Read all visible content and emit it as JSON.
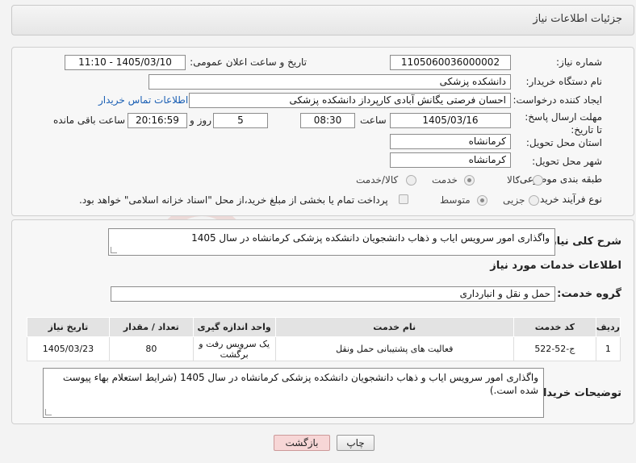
{
  "header": {
    "title": "جزئیات اطلاعات نیاز"
  },
  "fields": {
    "need_number_label": "شماره نیاز:",
    "need_number": "1105060036000002",
    "announce_label": "تاریخ و ساعت اعلان عمومی:",
    "announce_value": "1405/03/10 - 11:10",
    "buyer_org_label": "نام دستگاه خریدار:",
    "buyer_org": "دانشکده پزشکی",
    "creator_label": "ایجاد کننده درخواست:",
    "creator": "احسان فرصتی یگانش آبادی کارپرداز دانشکده پزشکی",
    "contact_link": "اطلاعات تماس خریدار",
    "deadline_label": "مهلت ارسال پاسخ: تا تاریخ:",
    "deadline_date": "1405/03/16",
    "time_label": "ساعت",
    "deadline_time": "08:30",
    "days_value": "5",
    "days_label": "روز و",
    "remaining_time": "20:16:59",
    "remaining_label": "ساعت باقی مانده",
    "province_label": "استان محل تحویل:",
    "province": "کرمانشاه",
    "city_label": "شهر محل تحویل:",
    "city": "کرمانشاه",
    "category_label": "طبقه بندی موضوعی:",
    "category_options": [
      "کالا",
      "خدمت",
      "کالا/خدمت"
    ],
    "process_label": "نوع فرآیند خرید :",
    "process_options": [
      "جزیی",
      "متوسط"
    ],
    "payment_note": "پرداخت تمام یا بخشی از مبلغ خرید،از محل \"اسناد خزانه اسلامی\" خواهد بود."
  },
  "summary": {
    "label": "شرح کلی نیاز:",
    "text": "واگذاری امور سرویس  ایاب و ذهاب دانشجویان دانشکده پزشکی کرمانشاه در سال 1405"
  },
  "services": {
    "title": "اطلاعات خدمات مورد نیاز",
    "group_label": "گروه خدمت:",
    "group_value": "حمل و نقل و انبارداری",
    "columns": [
      "ردیف",
      "کد خدمت",
      "نام خدمت",
      "واحد اندازه گیری",
      "تعداد / مقدار",
      "تاریخ نیاز"
    ],
    "rows": [
      [
        "1",
        "ج-52-522",
        "فعالیت های پشتیبانی حمل ونقل",
        "یک سرویس رفت و برگشت",
        "80",
        "1405/03/23"
      ]
    ]
  },
  "buyer_notes": {
    "label": "توضیحات خریدار:",
    "text": "واگذاری امور سرویس  ایاب و ذهاب دانشجویان دانشکده پزشکی کرمانشاه در سال 1405  (شرایط استعلام بهاء پیوست شده است.)"
  },
  "buttons": {
    "print": "چاپ",
    "back": "بازگشت"
  },
  "watermark_text": "AriaTender.neT",
  "colors": {
    "link": "#1a5fb4",
    "back_button": "#f7d6d6",
    "watermark": "#c0392b"
  }
}
